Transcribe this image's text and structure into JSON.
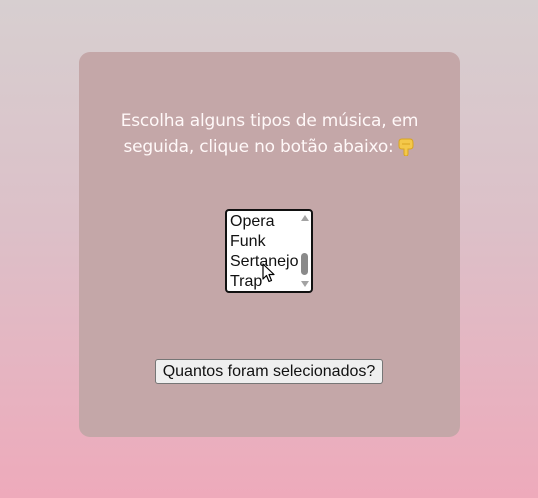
{
  "prompt": {
    "text": "Escolha alguns tipos de música, em seguida, clique no botão abaixo:",
    "icon": "pointing-down-hand-icon"
  },
  "genre_list": {
    "visible_options": [
      "Opera",
      "Funk",
      "Sertanejo",
      "Trap"
    ]
  },
  "count_button": {
    "label": "Quantos foram selecionados?"
  },
  "colors": {
    "card": "#c4a7a8",
    "background_top": "#d7cfd0",
    "background_bottom": "#eeaabb",
    "text": "#fff8f8"
  }
}
